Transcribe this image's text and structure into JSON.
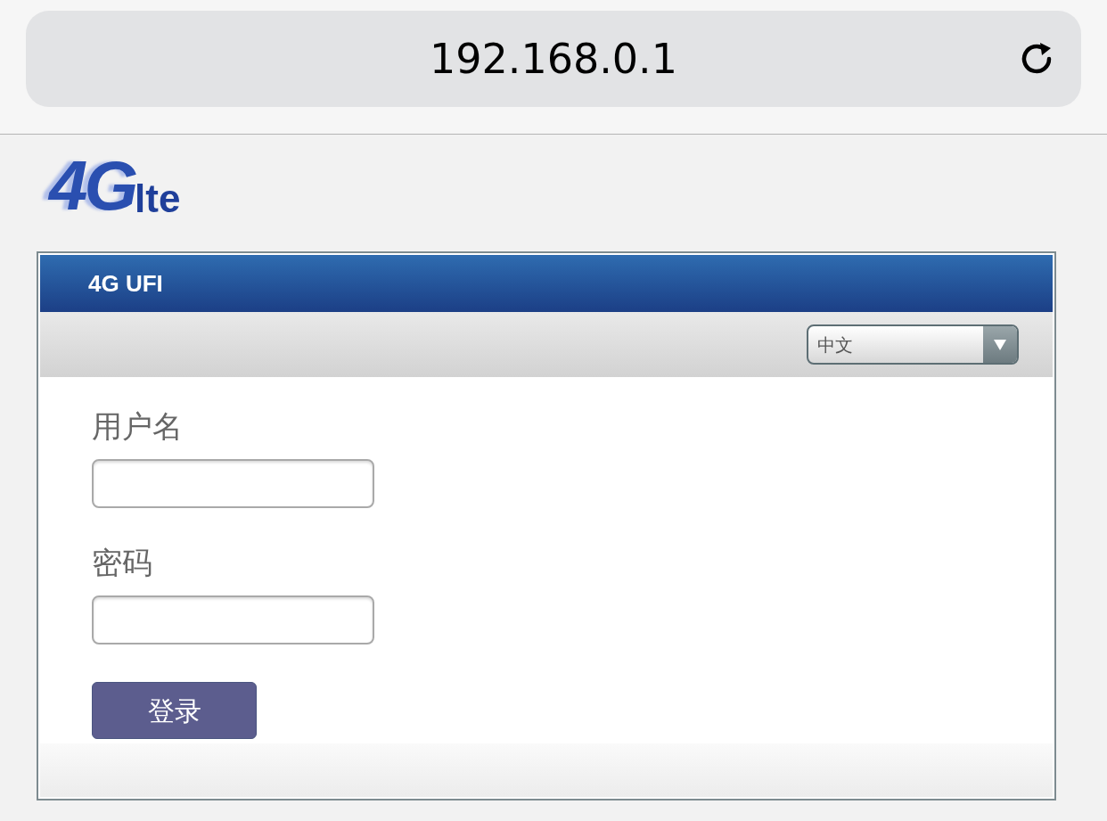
{
  "browser": {
    "address": "192.168.0.1"
  },
  "logo": {
    "main": "4G",
    "sub": "lte"
  },
  "panel": {
    "title": "4G UFI",
    "language": "中文"
  },
  "form": {
    "fields": [
      {
        "label": "用户名"
      },
      {
        "label": "密码"
      }
    ],
    "submit": "登录"
  }
}
